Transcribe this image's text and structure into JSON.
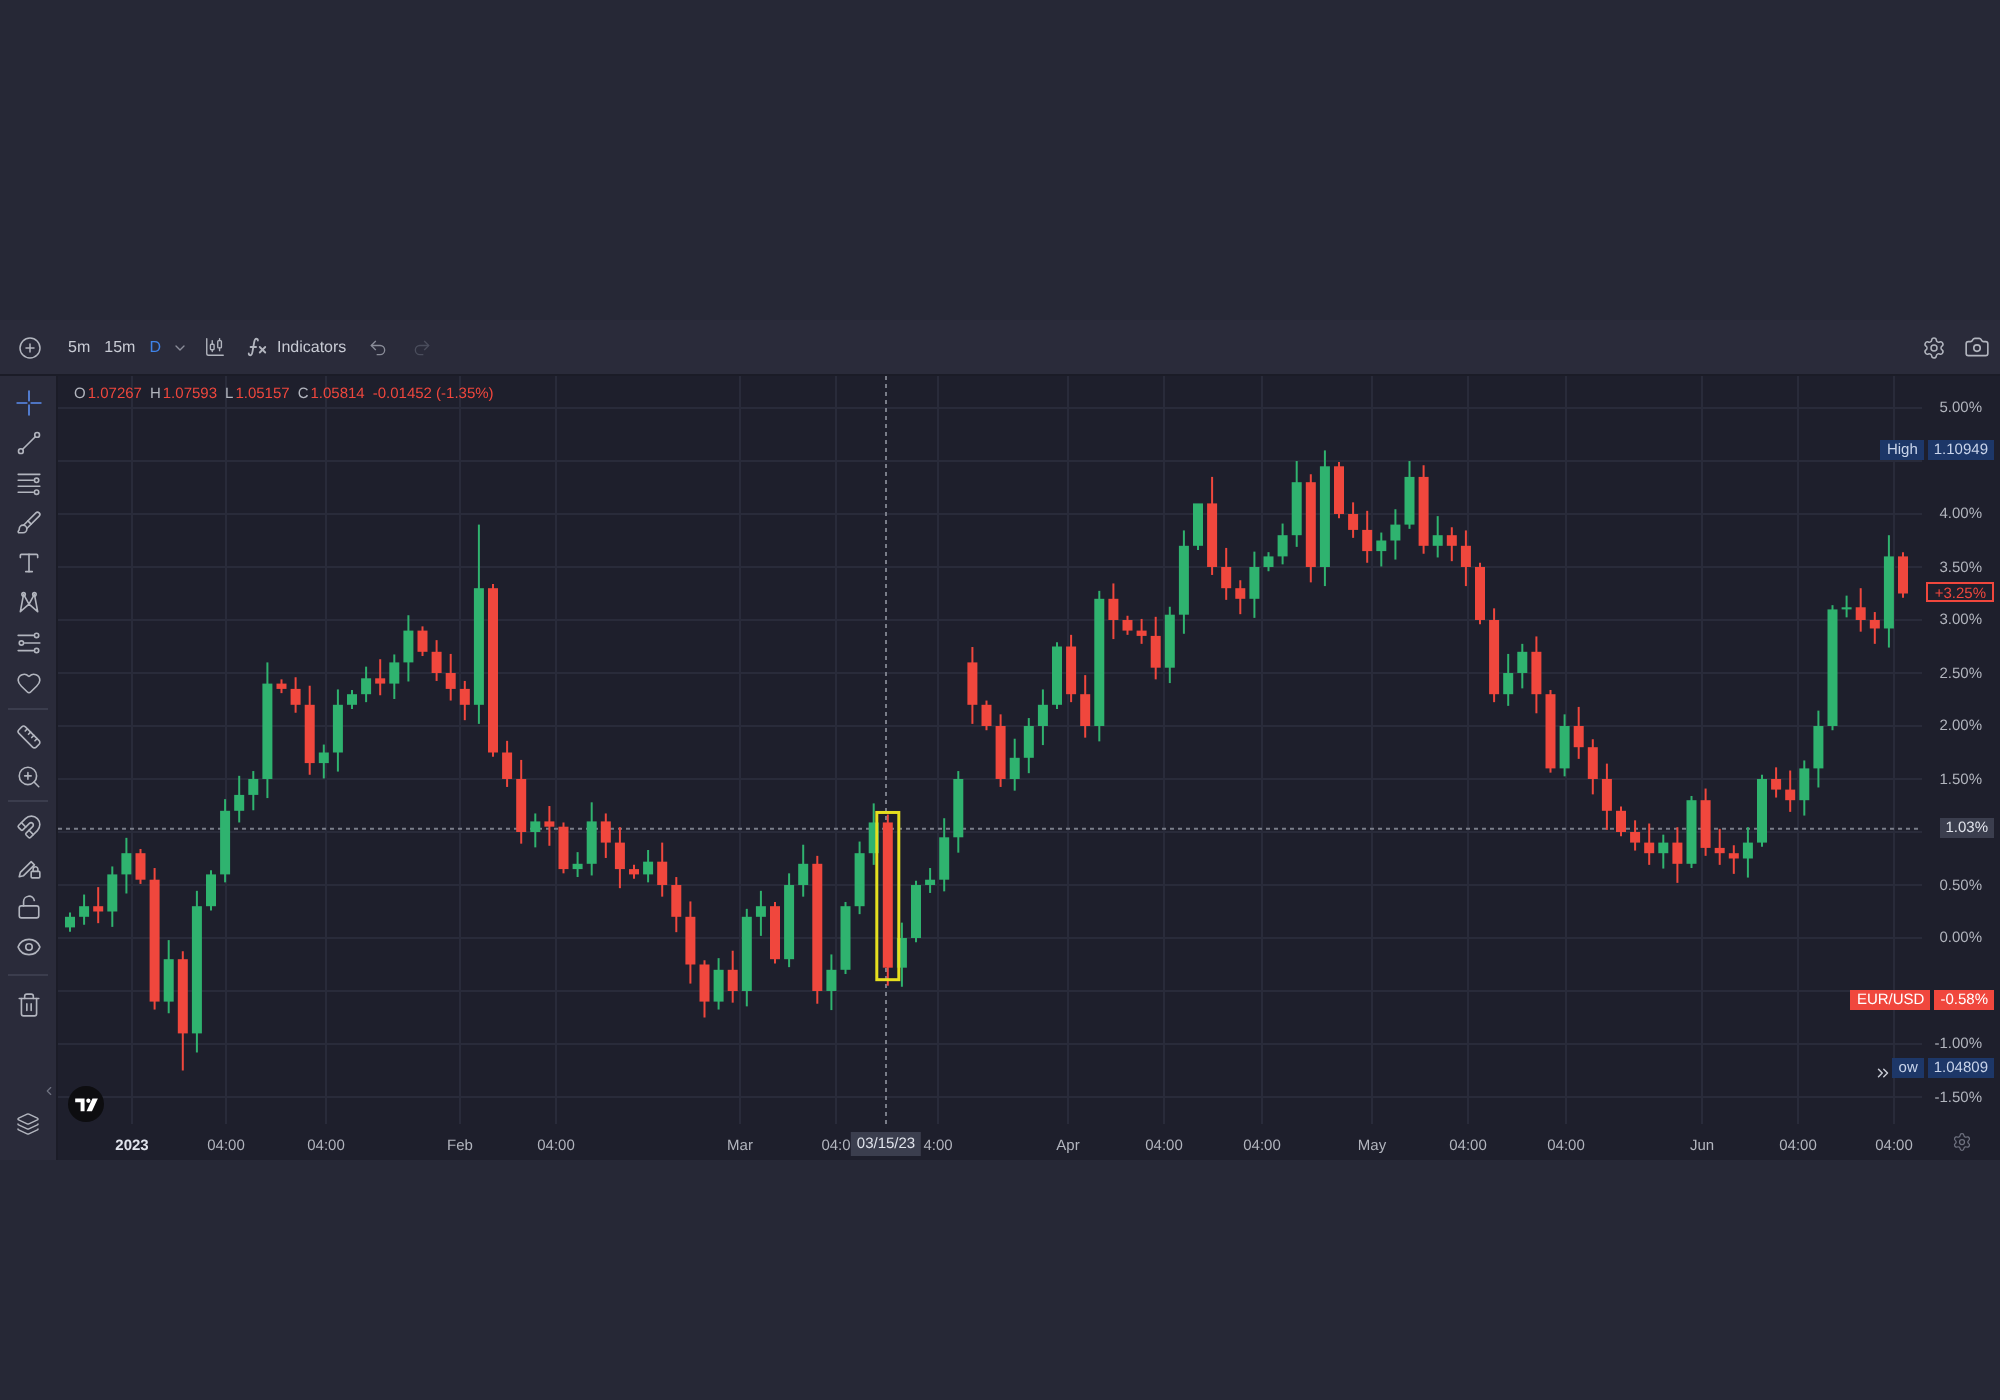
{
  "toolbar": {
    "intervals": [
      {
        "label": "5m",
        "selected": false
      },
      {
        "label": "15m",
        "selected": false
      },
      {
        "label": "D",
        "selected": true
      }
    ],
    "indicators": "Indicators",
    "history": [
      {
        "kind": "undo",
        "disabled": false
      },
      {
        "kind": "redo",
        "disabled": true
      }
    ]
  },
  "drawing_tools": [
    [
      {
        "kind": "crosshair",
        "selected": true
      },
      {
        "kind": "trend-line",
        "selected": false
      },
      {
        "kind": "parallel-lines",
        "selected": false
      },
      {
        "kind": "brush",
        "selected": false
      },
      {
        "kind": "text",
        "selected": false
      },
      {
        "kind": "pattern",
        "selected": false
      },
      {
        "kind": "projection",
        "selected": false
      },
      {
        "kind": "heart",
        "selected": false
      }
    ],
    [
      {
        "kind": "ruler",
        "selected": false
      },
      {
        "kind": "zoom-in",
        "selected": false
      }
    ],
    [
      {
        "kind": "magnet",
        "selected": false
      },
      {
        "kind": "pencil-lock",
        "selected": false
      },
      {
        "kind": "lock",
        "selected": false
      },
      {
        "kind": "eye",
        "selected": false
      }
    ],
    [
      {
        "kind": "trash",
        "selected": false
      }
    ]
  ],
  "legend": {
    "fields": [
      {
        "label": "O",
        "value": "1.07267"
      },
      {
        "label": "H",
        "value": "1.07593"
      },
      {
        "label": "L",
        "value": "1.05157"
      },
      {
        "label": "C",
        "value": "1.05814"
      }
    ],
    "change": "-0.01452 (-1.35%)"
  },
  "price_axis": {
    "ticks": [
      "5.00%",
      "4.00%",
      "3.50%",
      "3.00%",
      "2.50%",
      "2.00%",
      "1.50%",
      "0.50%",
      "0.00%",
      "-1.00%",
      "-1.50%"
    ]
  },
  "price_tags": [
    {
      "kind": "high",
      "label": "High",
      "value": "1.10949"
    },
    {
      "kind": "last",
      "value": "+3.25%"
    },
    {
      "kind": "crosshair",
      "value": "1.03%"
    },
    {
      "kind": "symbol",
      "label": "EUR/USD",
      "value": "-0.58%"
    },
    {
      "kind": "low",
      "label": "ow",
      "value": "1.04809"
    }
  ],
  "time_axis": {
    "labels": [
      {
        "kind": "year",
        "text": "2023"
      },
      {
        "kind": "tick",
        "text": "04:00"
      },
      {
        "kind": "tick",
        "text": "04:00"
      },
      {
        "kind": "tick",
        "text": "Feb"
      },
      {
        "kind": "tick",
        "text": "04:00"
      },
      {
        "kind": "tick",
        "text": "Mar"
      },
      {
        "kind": "tick",
        "text": "04:0"
      },
      {
        "kind": "tick",
        "text": "4:00"
      },
      {
        "kind": "tick",
        "text": "Apr"
      },
      {
        "kind": "tick",
        "text": "04:00"
      },
      {
        "kind": "tick",
        "text": "04:00"
      },
      {
        "kind": "tick",
        "text": "May"
      },
      {
        "kind": "tick",
        "text": "04:00"
      },
      {
        "kind": "tick",
        "text": "04:00"
      },
      {
        "kind": "tick",
        "text": "Jun"
      },
      {
        "kind": "tick",
        "text": "04:00"
      },
      {
        "kind": "tick",
        "text": "04:00"
      }
    ],
    "crosshair_label": "03/15/23"
  }
}
